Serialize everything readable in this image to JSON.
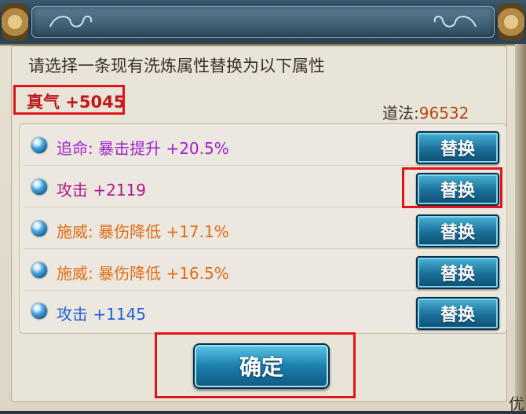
{
  "dialog": {
    "instruction": "请选择一条现有洗炼属性替换为以下属性",
    "new_attribute": "真气 +5045",
    "dao_label": "道法:",
    "dao_value": "96532"
  },
  "attributes": [
    {
      "text": "追命: 暴击提升 +20.5%",
      "color": "#a11fd0"
    },
    {
      "text": "攻击 +2119",
      "color": "#b1178f"
    },
    {
      "text": "施威: 暴伤降低 +17.1%",
      "color": "#e06c18"
    },
    {
      "text": "施威: 暴伤降低 +16.5%",
      "color": "#e06c18"
    },
    {
      "text": "攻击 +1145",
      "color": "#1f5fd8"
    }
  ],
  "buttons": {
    "swap_label": "替换",
    "confirm_label": "确定"
  },
  "edge_text": "优"
}
